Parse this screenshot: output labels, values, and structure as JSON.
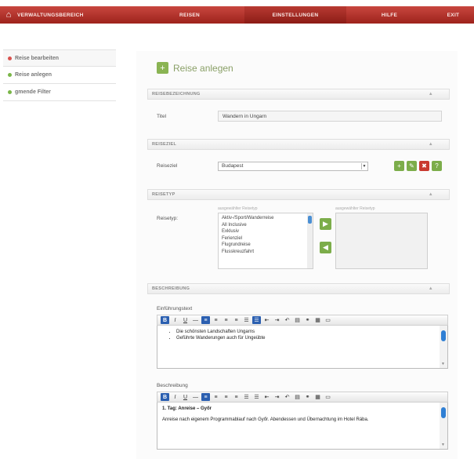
{
  "nav": {
    "brand": "Verwaltungsbereich",
    "items": [
      "Reisen",
      "Einstellungen",
      "Hilfe",
      "Exit"
    ]
  },
  "sidebar": {
    "items": [
      {
        "label": "Reise bearbeiten",
        "dot": "red"
      },
      {
        "label": "Reise anlegen",
        "dot": "green"
      },
      {
        "label": "gmende Filter",
        "dot": "green"
      }
    ]
  },
  "page_title": "Reise anlegen",
  "sections": {
    "reisebezeichnung": "Reisebezeichnung",
    "reiseziel": "Reiseziel",
    "reisetyp": "Reisetyp",
    "beschreibung": "Beschreibung"
  },
  "titel": {
    "label": "Titel",
    "value": "Wandern in Ungarn"
  },
  "reiseziel": {
    "label": "Reiseziel",
    "value": "Budapest"
  },
  "reisetyp": {
    "label": "Reisetyp:",
    "available_label": "ausgewählter Reisetyp",
    "selected_label": "ausgewählter Reisetyp",
    "options": [
      "Aktiv-/Sport/Wanderreise",
      "All Inclusive",
      "Exklusiv",
      "Ferienziel",
      "Flugrundreise",
      "Flusskreuzfahrt"
    ]
  },
  "einfuehrung": {
    "label": "Einführungstext",
    "bullets": [
      "Die schönsten Landschaften Ungarns",
      "Geführte Wanderungen auch für Ungeübte"
    ]
  },
  "beschreibung": {
    "label": "Beschreibung",
    "heading": "1. Tag: Anreise – Győr",
    "text": "Anreise nach eigenem Programmablauf nach Győr. Abendessen und Übernachtung im Hotel Rába."
  },
  "colors": {
    "nav": "#b0302a",
    "accent_green": "#7cad4a",
    "accent_red": "#c9392f"
  }
}
